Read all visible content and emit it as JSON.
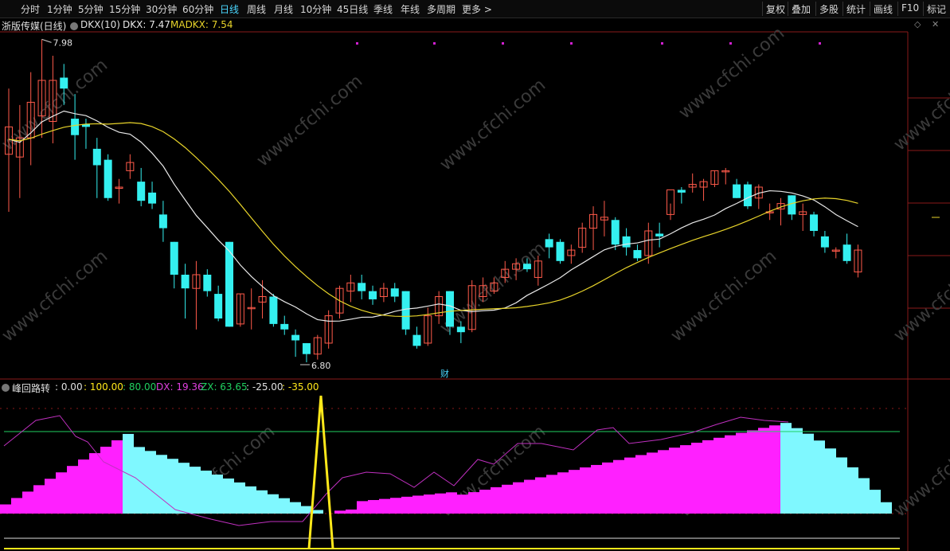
{
  "toolbar": {
    "periods": [
      {
        "label": "分时",
        "active": false
      },
      {
        "label": "1分钟",
        "active": false
      },
      {
        "label": "5分钟",
        "active": false
      },
      {
        "label": "15分钟",
        "active": false
      },
      {
        "label": "30分钟",
        "active": false
      },
      {
        "label": "60分钟",
        "active": false
      },
      {
        "label": "日线",
        "active": true
      },
      {
        "label": "周线",
        "active": false
      },
      {
        "label": "月线",
        "active": false
      },
      {
        "label": "10分钟",
        "active": false
      },
      {
        "label": "45日线",
        "active": false
      },
      {
        "label": "季线",
        "active": false
      },
      {
        "label": "年线",
        "active": false
      },
      {
        "label": "多周期",
        "active": false
      },
      {
        "label": "更多 >",
        "active": false
      }
    ],
    "right": [
      "复权",
      "叠加",
      "多股",
      "统计",
      "画线",
      "F10",
      "标记"
    ]
  },
  "main_header": {
    "stock_label": "浙版传媒(日线)",
    "indicator_name": "DKX(10)",
    "dkx_label": "DKX: 7.47",
    "madkx_label": "MADKX: 7.54"
  },
  "sub_header": {
    "indicator_name": "峰回路转",
    "v1": ": 0.00",
    "v2": ": 100.00",
    "v3": ": 80.00",
    "dx": "DX: 19.36",
    "zx": "ZX: 63.65",
    "v4": ": -25.00",
    "v5": ": -35.00"
  },
  "annotations": {
    "high_label": "7.98",
    "low_label": "6.80",
    "cai_label": "财"
  },
  "watermark": "www.cfchi.com",
  "colors": {
    "up": "#ff5a4a",
    "down": "#34f0f0",
    "dkx": "#e8e8e8",
    "madkx": "#e8d42a",
    "magenta": "#ff20ff",
    "cyanbar": "#7ff8ff",
    "dx": "#c030c0",
    "zx": "#20d060",
    "spike": "#ffe81a"
  },
  "chart_data": {
    "type": "candlestick",
    "panel_main": {
      "annotated_high": 7.98,
      "annotated_low": 6.8,
      "candles": [
        {
          "o": 7.56,
          "h": 7.8,
          "l": 7.35,
          "c": 7.66
        },
        {
          "o": 7.55,
          "h": 7.74,
          "l": 7.4,
          "c": 7.62
        },
        {
          "o": 7.62,
          "h": 7.86,
          "l": 7.52,
          "c": 7.75
        },
        {
          "o": 7.7,
          "h": 7.98,
          "l": 7.62,
          "c": 7.83
        },
        {
          "o": 7.68,
          "h": 7.92,
          "l": 7.6,
          "c": 7.83
        },
        {
          "o": 7.84,
          "h": 7.89,
          "l": 7.74,
          "c": 7.8
        },
        {
          "o": 7.69,
          "h": 7.78,
          "l": 7.54,
          "c": 7.63
        },
        {
          "o": 7.67,
          "h": 7.69,
          "l": 7.58,
          "c": 7.66
        },
        {
          "o": 7.58,
          "h": 7.62,
          "l": 7.4,
          "c": 7.52
        },
        {
          "o": 7.54,
          "h": 7.56,
          "l": 7.39,
          "c": 7.4
        },
        {
          "o": 7.44,
          "h": 7.47,
          "l": 7.38,
          "c": 7.44
        },
        {
          "o": 7.5,
          "h": 7.56,
          "l": 7.47,
          "c": 7.53
        },
        {
          "o": 7.46,
          "h": 7.51,
          "l": 7.37,
          "c": 7.39
        },
        {
          "o": 7.42,
          "h": 7.46,
          "l": 7.36,
          "c": 7.38
        },
        {
          "o": 7.34,
          "h": 7.39,
          "l": 7.24,
          "c": 7.29
        },
        {
          "o": 7.24,
          "h": 7.24,
          "l": 7.07,
          "c": 7.12
        },
        {
          "o": 7.12,
          "h": 7.16,
          "l": 6.96,
          "c": 7.07
        },
        {
          "o": 7.07,
          "h": 7.17,
          "l": 6.92,
          "c": 7.12
        },
        {
          "o": 7.12,
          "h": 7.14,
          "l": 7.04,
          "c": 7.06
        },
        {
          "o": 7.05,
          "h": 7.08,
          "l": 6.95,
          "c": 6.96
        },
        {
          "o": 7.24,
          "h": 7.24,
          "l": 6.93,
          "c": 6.93
        },
        {
          "o": 6.94,
          "h": 7.05,
          "l": 6.93,
          "c": 7.05
        },
        {
          "o": 7.0,
          "h": 7.07,
          "l": 6.92,
          "c": 7.0
        },
        {
          "o": 7.02,
          "h": 7.1,
          "l": 6.96,
          "c": 7.04
        },
        {
          "o": 7.04,
          "h": 7.05,
          "l": 6.93,
          "c": 6.94
        },
        {
          "o": 6.94,
          "h": 6.97,
          "l": 6.9,
          "c": 6.92
        },
        {
          "o": 6.9,
          "h": 6.92,
          "l": 6.82,
          "c": 6.88
        },
        {
          "o": 6.87,
          "h": 6.87,
          "l": 6.8,
          "c": 6.83
        },
        {
          "o": 6.83,
          "h": 6.9,
          "l": 6.81,
          "c": 6.89
        },
        {
          "o": 6.87,
          "h": 6.99,
          "l": 6.85,
          "c": 6.97
        },
        {
          "o": 6.98,
          "h": 7.08,
          "l": 6.96,
          "c": 7.07
        },
        {
          "o": 7.06,
          "h": 7.12,
          "l": 7.02,
          "c": 7.09
        },
        {
          "o": 7.09,
          "h": 7.12,
          "l": 7.03,
          "c": 7.06
        },
        {
          "o": 7.06,
          "h": 7.08,
          "l": 7.01,
          "c": 7.03
        },
        {
          "o": 7.04,
          "h": 7.09,
          "l": 7.02,
          "c": 7.07
        },
        {
          "o": 7.07,
          "h": 7.09,
          "l": 7.02,
          "c": 7.04
        },
        {
          "o": 7.06,
          "h": 7.06,
          "l": 6.9,
          "c": 6.92
        },
        {
          "o": 6.9,
          "h": 6.93,
          "l": 6.85,
          "c": 6.86
        },
        {
          "o": 6.87,
          "h": 7.0,
          "l": 6.86,
          "c": 6.97
        },
        {
          "o": 6.97,
          "h": 7.06,
          "l": 6.94,
          "c": 7.04
        },
        {
          "o": 7.06,
          "h": 7.06,
          "l": 6.9,
          "c": 6.93
        },
        {
          "o": 6.93,
          "h": 6.95,
          "l": 6.87,
          "c": 6.91
        },
        {
          "o": 6.92,
          "h": 7.1,
          "l": 6.91,
          "c": 7.08
        },
        {
          "o": 7.04,
          "h": 7.11,
          "l": 7.02,
          "c": 7.08
        },
        {
          "o": 7.06,
          "h": 7.11,
          "l": 7.05,
          "c": 7.09
        },
        {
          "o": 7.11,
          "h": 7.17,
          "l": 7.09,
          "c": 7.14
        },
        {
          "o": 7.14,
          "h": 7.18,
          "l": 7.1,
          "c": 7.16
        },
        {
          "o": 7.16,
          "h": 7.18,
          "l": 7.13,
          "c": 7.14
        },
        {
          "o": 7.11,
          "h": 7.19,
          "l": 7.08,
          "c": 7.17
        },
        {
          "o": 7.25,
          "h": 7.27,
          "l": 7.18,
          "c": 7.22
        },
        {
          "o": 7.24,
          "h": 7.25,
          "l": 7.16,
          "c": 7.17
        },
        {
          "o": 7.19,
          "h": 7.23,
          "l": 7.16,
          "c": 7.21
        },
        {
          "o": 7.22,
          "h": 7.31,
          "l": 7.2,
          "c": 7.29
        },
        {
          "o": 7.29,
          "h": 7.37,
          "l": 7.21,
          "c": 7.34
        },
        {
          "o": 7.32,
          "h": 7.39,
          "l": 7.26,
          "c": 7.33
        },
        {
          "o": 7.32,
          "h": 7.33,
          "l": 7.21,
          "c": 7.23
        },
        {
          "o": 7.26,
          "h": 7.29,
          "l": 7.19,
          "c": 7.22
        },
        {
          "o": 7.21,
          "h": 7.23,
          "l": 7.17,
          "c": 7.18
        },
        {
          "o": 7.19,
          "h": 7.31,
          "l": 7.16,
          "c": 7.28
        },
        {
          "o": 7.27,
          "h": 7.31,
          "l": 7.22,
          "c": 7.26
        },
        {
          "o": 7.34,
          "h": 7.38,
          "l": 7.32,
          "c": 7.43
        },
        {
          "o": 7.43,
          "h": 7.44,
          "l": 7.38,
          "c": 7.42
        },
        {
          "o": 7.44,
          "h": 7.49,
          "l": 7.42,
          "c": 7.45
        },
        {
          "o": 7.44,
          "h": 7.47,
          "l": 7.39,
          "c": 7.46
        },
        {
          "o": 7.45,
          "h": 7.5,
          "l": 7.44,
          "c": 7.5
        },
        {
          "o": 7.5,
          "h": 7.51,
          "l": 7.45,
          "c": 7.5
        },
        {
          "o": 7.45,
          "h": 7.47,
          "l": 7.4,
          "c": 7.4
        },
        {
          "o": 7.45,
          "h": 7.46,
          "l": 7.36,
          "c": 7.37
        },
        {
          "o": 7.4,
          "h": 7.45,
          "l": 7.36,
          "c": 7.44
        },
        {
          "o": 7.35,
          "h": 7.38,
          "l": 7.32,
          "c": 7.35
        },
        {
          "o": 7.36,
          "h": 7.4,
          "l": 7.3,
          "c": 7.38
        },
        {
          "o": 7.41,
          "h": 7.41,
          "l": 7.32,
          "c": 7.34
        },
        {
          "o": 7.34,
          "h": 7.38,
          "l": 7.28,
          "c": 7.35
        },
        {
          "o": 7.34,
          "h": 7.35,
          "l": 7.26,
          "c": 7.28
        },
        {
          "o": 7.26,
          "h": 7.28,
          "l": 7.2,
          "c": 7.22
        },
        {
          "o": 7.21,
          "h": 7.22,
          "l": 7.18,
          "c": 7.21
        },
        {
          "o": 7.23,
          "h": 7.27,
          "l": 7.16,
          "c": 7.17
        },
        {
          "o": 7.13,
          "h": 7.23,
          "l": 7.11,
          "c": 7.21
        }
      ]
    },
    "panel_sub": {
      "levels": [
        0,
        100,
        80,
        -25,
        -35
      ],
      "last": {
        "DX": 19.36,
        "ZX": 63.65
      }
    }
  }
}
